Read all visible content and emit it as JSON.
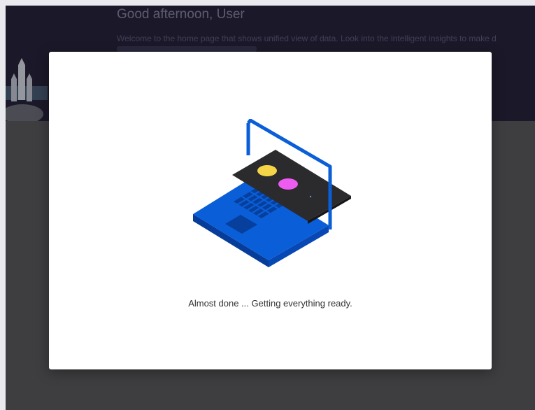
{
  "home": {
    "greeting": "Good afternoon, User",
    "welcome_text": "Welcome to the home page that shows unified view of data. Look into the intelligent insights to make d"
  },
  "loading_dialog": {
    "illustration": "laptop-icon",
    "status_text": "Almost done ... Getting everything ready."
  },
  "colors": {
    "hero_background": "#151229",
    "laptop_blue": "#0a5ed7",
    "accent_yellow": "#f5d547",
    "accent_pink": "#ee5bf0"
  }
}
